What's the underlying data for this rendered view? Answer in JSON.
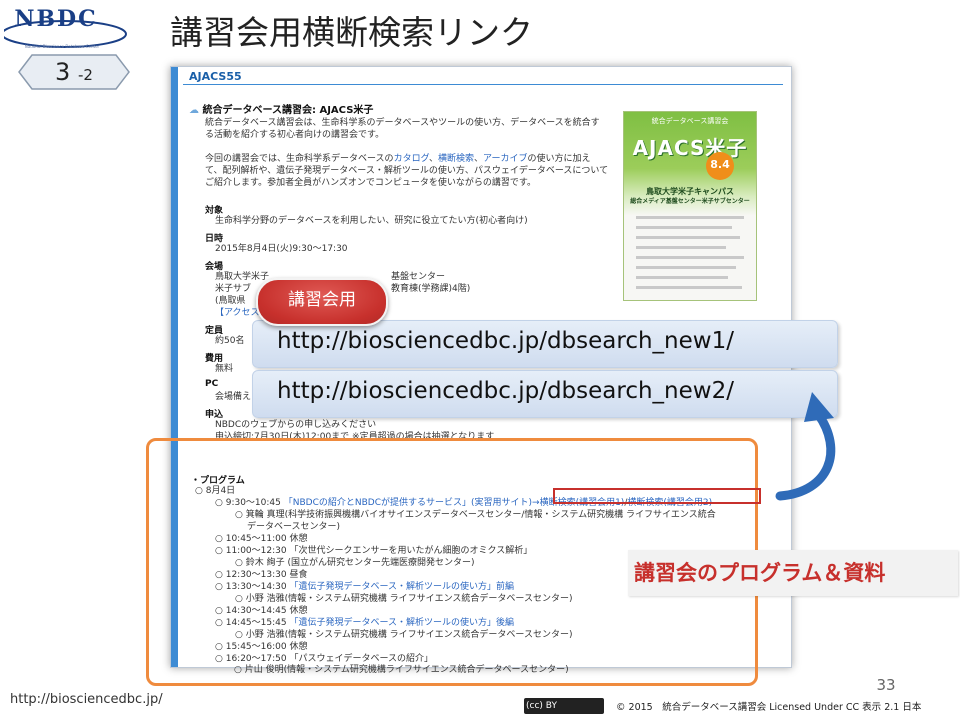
{
  "header": {
    "logo_text": "NBDC",
    "logo_subtext": "National Bioscience Database Center",
    "title": "講習会用横断検索リンク",
    "page_badge_main": "3",
    "page_badge_sub": "-2"
  },
  "screenshot": {
    "header": "AJACS55",
    "course_title": "統合データベース講習会: AJACS米子",
    "intro_1": "統合データベース講習会は、生命科学系のデータベースやツールの使い方、データベースを統合す",
    "intro_2": "る活動を紹介する初心者向けの講習会です。",
    "intro_3a": "今回の講習会では、生命科学系データベースの",
    "intro_3_link1": "カタログ",
    "intro_3_sep1": "、",
    "intro_3_link2": "横断検索",
    "intro_3_sep2": "、",
    "intro_3_link3": "アーカイブ",
    "intro_3b": "の使い方に加え",
    "intro_4": "て、配列解析や、遺伝子発現データベース・解析ツールの使い方、パスウェイデータベースについて",
    "intro_5": "ご紹介します。参加者全員がハンズオンでコンピュータを使いながらの講習です。",
    "target_label": "対象",
    "target_value": "生命科学分野のデータベースを利用したい、研究に役立てたい方(初心者向け)",
    "date_label": "日時",
    "date_value": "2015年8月4日(火)9:30～17:30",
    "venue_label": "会場",
    "venue_1": "鳥取大学米子",
    "venue_1b": "基盤センター",
    "venue_2": "米子サブ",
    "venue_2b": "教育棟(学務課)4階)",
    "venue_3": "(鳥取県",
    "venue_access": "【アクセス】",
    "capacity_label": "定員",
    "capacity_value": "約50名",
    "fee_label": "費用",
    "fee_value": "無料",
    "pc_label": "PC",
    "pc_value": "会場備え",
    "apply_label": "申込",
    "apply_1": "NBDCのウェブからの申し込みください",
    "apply_2": "申込締切:7月30日(木)12:00まで ※定員超過の場合は抽選となります",
    "program_label": "プログラム",
    "program_date": "8月4日",
    "program": [
      {
        "time": "9:30～10:45",
        "title": "「NBDCの紹介とNBDCが提供するサービス」(実習用サイト)",
        "link1": "→横断検索(講習会用1)",
        "sep": "/",
        "link2": "横断検索(講習会用2)"
      },
      {
        "speaker": "箕輪 真理(科学技術振興機構バイオサイエンスデータベースセンター/情報・システム研究機構 ライフサイエンス統合"
      },
      {
        "speaker": "データベースセンター)"
      },
      {
        "time": "10:45～11:00",
        "title": "休憩"
      },
      {
        "time": "11:00～12:30",
        "title": "「次世代シークエンサーを用いたがん細胞のオミクス解析」"
      },
      {
        "speaker": "鈴木 絢子 (国立がん研究センター先端医療開発センター)"
      },
      {
        "time": "12:30～13:30",
        "title": "昼食"
      },
      {
        "time": "13:30～14:30",
        "title": "「遺伝子発現データベース・解析ツールの使い方」前編"
      },
      {
        "speaker": "小野 浩雅(情報・システム研究機構 ライフサイエンス統合データベースセンター)"
      },
      {
        "time": "14:30～14:45",
        "title": "休憩"
      },
      {
        "time": "14:45～15:45",
        "title": "「遺伝子発現データベース・解析ツールの使い方」後編"
      },
      {
        "speaker": "小野 浩雅(情報・システム研究機構 ライフサイエンス統合データベースセンター)"
      },
      {
        "time": "15:45～16:00",
        "title": "休憩"
      },
      {
        "time": "16:20～17:50",
        "title": "「パスウェイデータベースの紹介」"
      },
      {
        "speaker": "片山 俊明(情報・システム研究機構ライフサイエンス統合データベースセンター)"
      }
    ],
    "poster": {
      "small_title": "統合データベース講習会",
      "title": "AJACS米子",
      "date": "8.4",
      "venue_1": "鳥取大学米子キャンパス",
      "venue_2": "総合メディア基盤センター米子サブセンター"
    }
  },
  "overlay": {
    "pill_label": "講習会用",
    "url1": "http://biosciencedbc.jp/dbsearch_new1/",
    "url2": "http://biosciencedbc.jp/dbsearch_new2/",
    "callout": "講習会のプログラム＆資料"
  },
  "footer": {
    "page_number": "33",
    "url": "http://biosciencedbc.jp/",
    "cc_badge": "(cc) BY",
    "copyright": "© 2015　統合データベース講習会 Licensed Under CC 表示 2.1 日本"
  },
  "colors": {
    "accent_blue": "#3d8bd4",
    "link_blue": "#2a66c0",
    "pill_red": "#c7302c",
    "box_orange": "#ef8b3e",
    "arrow_blue": "#2f6bb8"
  }
}
